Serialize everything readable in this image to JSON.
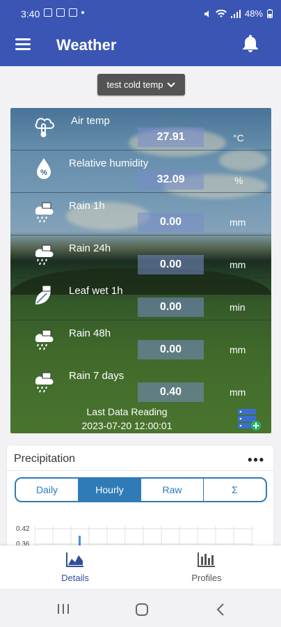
{
  "status_bar": {
    "time": "3:40",
    "battery": "48%"
  },
  "app_bar": {
    "title": "Weather"
  },
  "selector": {
    "value": "test cold temp"
  },
  "sensors": [
    {
      "label": "Air temp",
      "value": "27.91",
      "unit": "°C",
      "icon": "thermometer-cloud-icon"
    },
    {
      "label": "Relative humidity",
      "value": "32.09",
      "unit": "%",
      "icon": "humidity-drop-icon"
    },
    {
      "label": "Rain 1h",
      "value": "0.00",
      "unit": "mm",
      "icon": "rain-1h-icon"
    },
    {
      "label": "Rain 24h",
      "value": "0.00",
      "unit": "mm",
      "icon": "rain-24h-icon"
    },
    {
      "label": "Leaf wet 1h",
      "value": "0.00",
      "unit": "min",
      "icon": "leaf-wetness-icon"
    },
    {
      "label": "Rain 48h",
      "value": "0.00",
      "unit": "mm",
      "icon": "rain-48h-icon"
    },
    {
      "label": "Rain 7 days",
      "value": "0.40",
      "unit": "mm",
      "icon": "rain-7d-icon"
    }
  ],
  "last_reading": {
    "label": "Last Data Reading",
    "value": "2023-07-20 12:00:01"
  },
  "precipitation": {
    "title": "Precipitation",
    "more": "•••",
    "tabs": [
      {
        "label": "Daily",
        "active": false
      },
      {
        "label": "Hourly",
        "active": true
      },
      {
        "label": "Raw",
        "active": false
      },
      {
        "label": "Σ",
        "active": false
      }
    ],
    "chart_ticks": [
      "0.42",
      "0.36"
    ]
  },
  "bottom_nav": [
    {
      "label": "Details",
      "active": true,
      "icon": "area-chart-icon"
    },
    {
      "label": "Profiles",
      "active": false,
      "icon": "bar-chart-icon"
    }
  ],
  "colors": {
    "primary": "#3a55b4",
    "accent": "#2e7bb8"
  }
}
